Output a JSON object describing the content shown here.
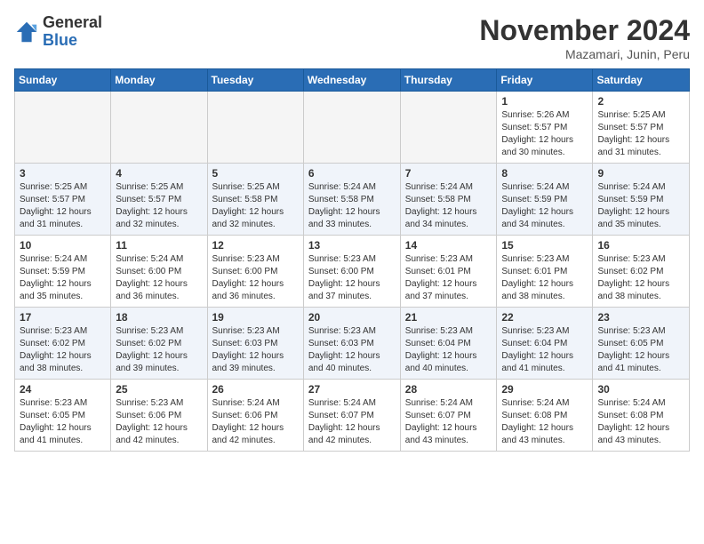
{
  "header": {
    "logo": {
      "line1": "General",
      "line2": "Blue"
    },
    "title": "November 2024",
    "subtitle": "Mazamari, Junin, Peru"
  },
  "weekdays": [
    "Sunday",
    "Monday",
    "Tuesday",
    "Wednesday",
    "Thursday",
    "Friday",
    "Saturday"
  ],
  "weeks": [
    [
      {
        "day": "",
        "info": ""
      },
      {
        "day": "",
        "info": ""
      },
      {
        "day": "",
        "info": ""
      },
      {
        "day": "",
        "info": ""
      },
      {
        "day": "",
        "info": ""
      },
      {
        "day": "1",
        "info": "Sunrise: 5:26 AM\nSunset: 5:57 PM\nDaylight: 12 hours and 30 minutes."
      },
      {
        "day": "2",
        "info": "Sunrise: 5:25 AM\nSunset: 5:57 PM\nDaylight: 12 hours and 31 minutes."
      }
    ],
    [
      {
        "day": "3",
        "info": "Sunrise: 5:25 AM\nSunset: 5:57 PM\nDaylight: 12 hours and 31 minutes."
      },
      {
        "day": "4",
        "info": "Sunrise: 5:25 AM\nSunset: 5:57 PM\nDaylight: 12 hours and 32 minutes."
      },
      {
        "day": "5",
        "info": "Sunrise: 5:25 AM\nSunset: 5:58 PM\nDaylight: 12 hours and 32 minutes."
      },
      {
        "day": "6",
        "info": "Sunrise: 5:24 AM\nSunset: 5:58 PM\nDaylight: 12 hours and 33 minutes."
      },
      {
        "day": "7",
        "info": "Sunrise: 5:24 AM\nSunset: 5:58 PM\nDaylight: 12 hours and 34 minutes."
      },
      {
        "day": "8",
        "info": "Sunrise: 5:24 AM\nSunset: 5:59 PM\nDaylight: 12 hours and 34 minutes."
      },
      {
        "day": "9",
        "info": "Sunrise: 5:24 AM\nSunset: 5:59 PM\nDaylight: 12 hours and 35 minutes."
      }
    ],
    [
      {
        "day": "10",
        "info": "Sunrise: 5:24 AM\nSunset: 5:59 PM\nDaylight: 12 hours and 35 minutes."
      },
      {
        "day": "11",
        "info": "Sunrise: 5:24 AM\nSunset: 6:00 PM\nDaylight: 12 hours and 36 minutes."
      },
      {
        "day": "12",
        "info": "Sunrise: 5:23 AM\nSunset: 6:00 PM\nDaylight: 12 hours and 36 minutes."
      },
      {
        "day": "13",
        "info": "Sunrise: 5:23 AM\nSunset: 6:00 PM\nDaylight: 12 hours and 37 minutes."
      },
      {
        "day": "14",
        "info": "Sunrise: 5:23 AM\nSunset: 6:01 PM\nDaylight: 12 hours and 37 minutes."
      },
      {
        "day": "15",
        "info": "Sunrise: 5:23 AM\nSunset: 6:01 PM\nDaylight: 12 hours and 38 minutes."
      },
      {
        "day": "16",
        "info": "Sunrise: 5:23 AM\nSunset: 6:02 PM\nDaylight: 12 hours and 38 minutes."
      }
    ],
    [
      {
        "day": "17",
        "info": "Sunrise: 5:23 AM\nSunset: 6:02 PM\nDaylight: 12 hours and 38 minutes."
      },
      {
        "day": "18",
        "info": "Sunrise: 5:23 AM\nSunset: 6:02 PM\nDaylight: 12 hours and 39 minutes."
      },
      {
        "day": "19",
        "info": "Sunrise: 5:23 AM\nSunset: 6:03 PM\nDaylight: 12 hours and 39 minutes."
      },
      {
        "day": "20",
        "info": "Sunrise: 5:23 AM\nSunset: 6:03 PM\nDaylight: 12 hours and 40 minutes."
      },
      {
        "day": "21",
        "info": "Sunrise: 5:23 AM\nSunset: 6:04 PM\nDaylight: 12 hours and 40 minutes."
      },
      {
        "day": "22",
        "info": "Sunrise: 5:23 AM\nSunset: 6:04 PM\nDaylight: 12 hours and 41 minutes."
      },
      {
        "day": "23",
        "info": "Sunrise: 5:23 AM\nSunset: 6:05 PM\nDaylight: 12 hours and 41 minutes."
      }
    ],
    [
      {
        "day": "24",
        "info": "Sunrise: 5:23 AM\nSunset: 6:05 PM\nDaylight: 12 hours and 41 minutes."
      },
      {
        "day": "25",
        "info": "Sunrise: 5:23 AM\nSunset: 6:06 PM\nDaylight: 12 hours and 42 minutes."
      },
      {
        "day": "26",
        "info": "Sunrise: 5:24 AM\nSunset: 6:06 PM\nDaylight: 12 hours and 42 minutes."
      },
      {
        "day": "27",
        "info": "Sunrise: 5:24 AM\nSunset: 6:07 PM\nDaylight: 12 hours and 42 minutes."
      },
      {
        "day": "28",
        "info": "Sunrise: 5:24 AM\nSunset: 6:07 PM\nDaylight: 12 hours and 43 minutes."
      },
      {
        "day": "29",
        "info": "Sunrise: 5:24 AM\nSunset: 6:08 PM\nDaylight: 12 hours and 43 minutes."
      },
      {
        "day": "30",
        "info": "Sunrise: 5:24 AM\nSunset: 6:08 PM\nDaylight: 12 hours and 43 minutes."
      }
    ]
  ]
}
